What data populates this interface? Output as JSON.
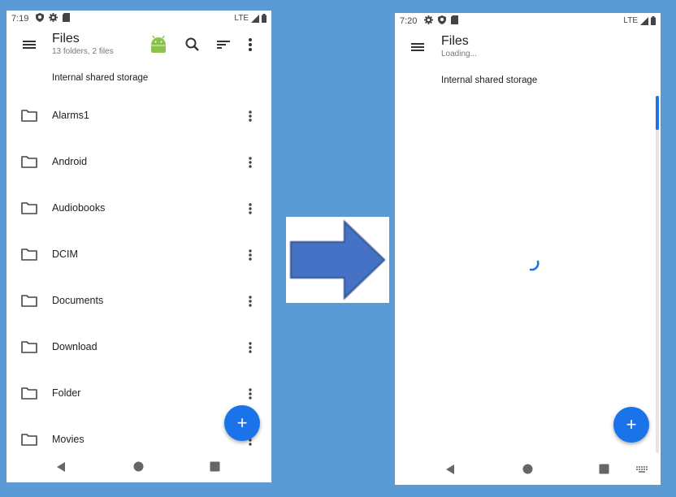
{
  "left_screen": {
    "status": {
      "time": "7:19",
      "network": "LTE"
    },
    "app_bar": {
      "title": "Files",
      "subtitle": "13 folders, 2 files"
    },
    "storage_label": "Internal shared storage",
    "folders": [
      {
        "name": "Alarms1"
      },
      {
        "name": "Android"
      },
      {
        "name": "Audiobooks"
      },
      {
        "name": "DCIM"
      },
      {
        "name": "Documents"
      },
      {
        "name": "Download"
      },
      {
        "name": "Folder"
      },
      {
        "name": "Movies"
      }
    ],
    "fab": {
      "label": "+"
    }
  },
  "right_screen": {
    "status": {
      "time": "7:20",
      "network": "LTE"
    },
    "app_bar": {
      "title": "Files",
      "subtitle": "Loading..."
    },
    "storage_label": "Internal shared storage",
    "fab": {
      "label": "+"
    }
  },
  "colors": {
    "background": "#5b9bd5",
    "accent": "#1a73e8",
    "arrow_fill": "#4472c4",
    "android_green": "#8bc34a"
  },
  "icons": {
    "status_left": [
      "gear-icon",
      "shield-icon",
      "sd-card-icon"
    ],
    "status_right": [
      "signal-icon",
      "battery-icon"
    ],
    "app_bar_left": [
      "android-icon",
      "search-icon",
      "sort-icon",
      "more-vert-icon"
    ],
    "app_bar_right": [],
    "nav": [
      "back-icon",
      "home-icon",
      "recents-icon"
    ],
    "right_nav_extra": [
      "keyboard-icon"
    ]
  }
}
